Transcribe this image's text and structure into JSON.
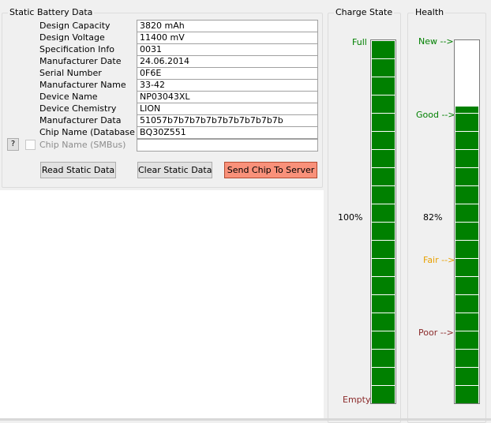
{
  "static_group": {
    "title": "Static Battery Data",
    "fields": [
      {
        "label": "Design Capacity",
        "value": "3820 mAh"
      },
      {
        "label": "Design Voltage",
        "value": "11400 mV"
      },
      {
        "label": "Specification Info",
        "value": "0031"
      },
      {
        "label": "Manufacturer Date",
        "value": "24.06.2014"
      },
      {
        "label": "Serial Number",
        "value": "0F6E"
      },
      {
        "label": "Manufacturer Name",
        "value": "33-42"
      },
      {
        "label": "Device Name",
        "value": "NP03043XL"
      },
      {
        "label": "Device Chemistry",
        "value": "LION"
      },
      {
        "label": "Manufacturer Data",
        "value": "51057b7b7b7b7b7b7b7b7b7b7b"
      },
      {
        "label": "Chip Name (Database)",
        "value": "BQ30Z551"
      }
    ],
    "smbus": {
      "label": "Chip Name (SMBus)",
      "value": "",
      "checked": false,
      "help": "?"
    },
    "buttons": {
      "read": "Read Static Data",
      "clear": "Clear Static Data",
      "send": "Send Chip To Server"
    }
  },
  "charge_state": {
    "title": "Charge State",
    "full_label": "Full",
    "empty_label": "Empty",
    "percent_text": "100%",
    "level": 1.0,
    "colors": {
      "full": "#008000",
      "empty": "#8b2a2a",
      "fill": "#008000"
    }
  },
  "health": {
    "title": "Health",
    "new_label": "New -->",
    "good_label": "Good -->",
    "fair_label": "Fair -->",
    "poor_label": "Poor -->",
    "percent_text": "82%",
    "level": 0.82,
    "colors": {
      "new": "#008000",
      "good": "#008000",
      "fair": "#e8a000",
      "poor": "#8b2a2a",
      "fill": "#008000"
    }
  }
}
